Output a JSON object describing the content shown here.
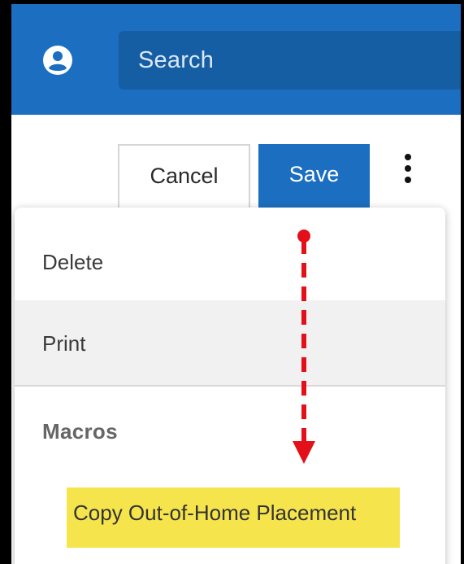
{
  "search": {
    "placeholder": "Search"
  },
  "toolbar": {
    "cancel_label": "Cancel",
    "save_label": "Save"
  },
  "menu": {
    "items": [
      {
        "label": "Delete"
      },
      {
        "label": "Print"
      }
    ],
    "macros_header": "Macros",
    "macros": [
      {
        "label": "Copy Out-of-Home Placement",
        "highlighted": true
      }
    ]
  },
  "colors": {
    "app_bar": "#1c6fc0",
    "search_box": "#155ea4",
    "save_button": "#1c6fc0",
    "highlight": "#f5e44c",
    "annotation_arrow": "#e3101a"
  },
  "icons": {
    "user": "user-circle-icon",
    "more": "more-vertical-icon"
  }
}
